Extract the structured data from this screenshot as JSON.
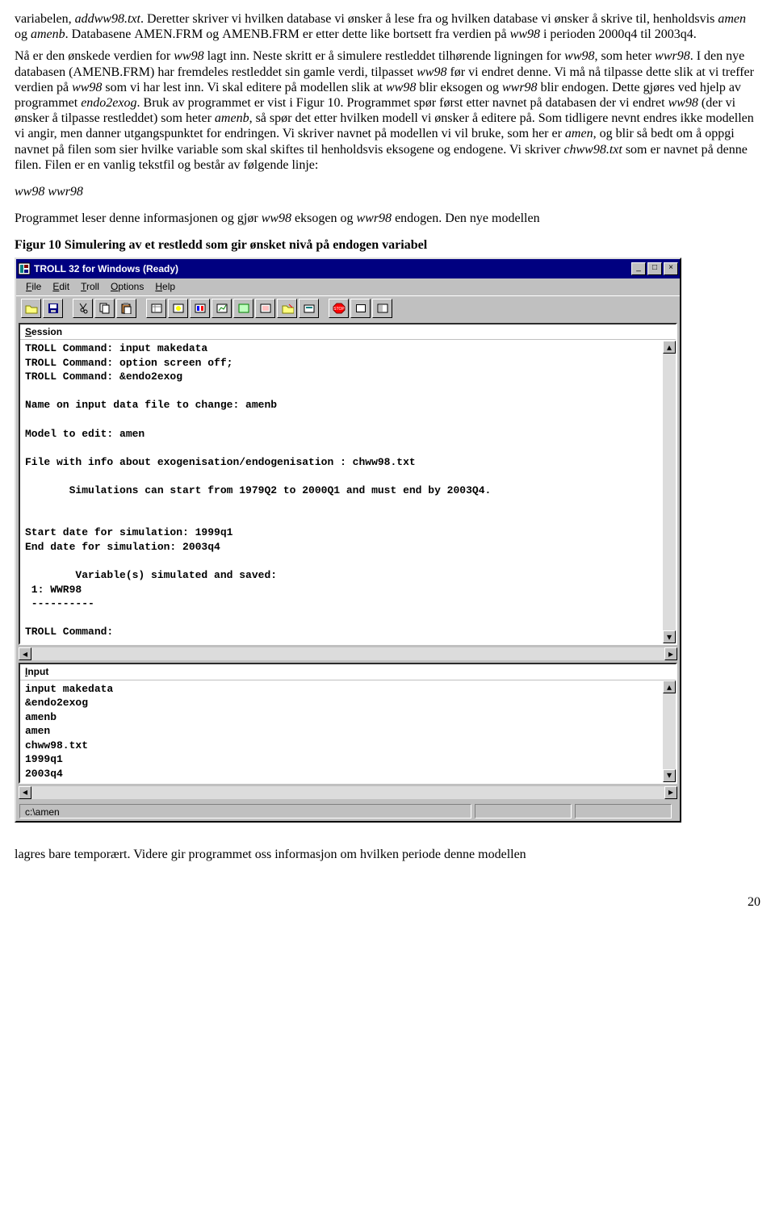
{
  "paragraph1_parts": [
    {
      "t": "variabelen, ",
      "i": false
    },
    {
      "t": "addww98.txt",
      "i": true
    },
    {
      "t": ". Deretter skriver vi hvilken database vi ønsker å lese fra og hvilken database vi ønsker å skrive til, henholdsvis ",
      "i": false
    },
    {
      "t": "amen",
      "i": true
    },
    {
      "t": " og ",
      "i": false
    },
    {
      "t": "amenb",
      "i": true
    },
    {
      "t": ". Databasene ",
      "i": false
    },
    {
      "t": "AMEN.FRM",
      "i": false,
      "sc": true
    },
    {
      "t": " og ",
      "i": false
    },
    {
      "t": "AMENB.FRM",
      "i": false,
      "sc": true
    },
    {
      "t": " er etter dette like bortsett fra verdien på ",
      "i": false
    },
    {
      "t": "ww98",
      "i": true
    },
    {
      "t": " i perioden 2000q4 til 2003q4.",
      "i": false
    }
  ],
  "paragraph2_parts": [
    {
      "t": "Nå er den ønskede verdien for ",
      "i": false
    },
    {
      "t": "ww98",
      "i": true
    },
    {
      "t": " lagt inn. Neste skritt er å simulere restleddet tilhørende ligningen for ",
      "i": false
    },
    {
      "t": "ww98",
      "i": true
    },
    {
      "t": ", som heter ",
      "i": false
    },
    {
      "t": "wwr98",
      "i": true
    },
    {
      "t": ". I den nye databasen (",
      "i": false
    },
    {
      "t": "AMENB.FRM",
      "i": false,
      "sc": true
    },
    {
      "t": ") har fremdeles restleddet sin gamle verdi, tilpasset ",
      "i": false
    },
    {
      "t": "ww98",
      "i": true
    },
    {
      "t": " før vi endret denne. Vi må nå tilpasse dette slik at vi treffer verdien på ",
      "i": false
    },
    {
      "t": "ww98",
      "i": true
    },
    {
      "t": " som vi har lest inn. Vi skal editere på modellen slik at ",
      "i": false
    },
    {
      "t": "ww98",
      "i": true
    },
    {
      "t": " blir eksogen og ",
      "i": false
    },
    {
      "t": "wwr98",
      "i": true
    },
    {
      "t": " blir endogen. Dette gjøres ved hjelp av programmet ",
      "i": false
    },
    {
      "t": "endo2exog",
      "i": true
    },
    {
      "t": ". Bruk av programmet er vist i Figur 10. Programmet spør først etter navnet på databasen der vi endret ",
      "i": false
    },
    {
      "t": "ww98",
      "i": true
    },
    {
      "t": " (der vi ønsker å tilpasse restleddet) som heter ",
      "i": false
    },
    {
      "t": "amenb",
      "i": true
    },
    {
      "t": ", så spør det etter hvilken modell vi ønsker å editere på. Som tidligere nevnt endres ikke modellen vi angir, men danner utgangspunktet for endringen. Vi skriver navnet på modellen vi vil bruke, som her er ",
      "i": false
    },
    {
      "t": "amen",
      "i": true
    },
    {
      "t": ", og blir så bedt om å oppgi navnet på filen som sier hvilke variable som skal skiftes til henholdsvis eksogene og endogene. Vi skriver ",
      "i": false
    },
    {
      "t": "chww98.txt",
      "i": true
    },
    {
      "t": " som er navnet på denne filen. Filen er en vanlig tekstfil og består av følgende linje:",
      "i": false
    }
  ],
  "codeline": "ww98 wwr98",
  "paragraph3_parts": [
    {
      "t": "Programmet leser denne informasjonen og gjør ",
      "i": false
    },
    {
      "t": "ww98",
      "i": true
    },
    {
      "t": " eksogen og ",
      "i": false
    },
    {
      "t": "wwr98",
      "i": true
    },
    {
      "t": " endogen. Den nye modellen",
      "i": false
    }
  ],
  "figure_caption": "Figur 10 Simulering av et restledd som gir ønsket nivå på endogen variabel",
  "window": {
    "title": "TROLL 32 for Windows (Ready)",
    "menus": [
      "File",
      "Edit",
      "Troll",
      "Options",
      "Help"
    ],
    "session_label": "Session",
    "session_lines": [
      "TROLL Command: input makedata",
      "TROLL Command: option screen off;",
      "TROLL Command: &endo2exog",
      "",
      "Name on input data file to change: amenb",
      "",
      "Model to edit: amen",
      "",
      "File with info about exogenisation/endogenisation : chww98.txt",
      "",
      "       Simulations can start from 1979Q2 to 2000Q1 and must end by 2003Q4.",
      "",
      "",
      "Start date for simulation: 1999q1",
      "End date for simulation: 2003q4",
      "",
      "        Variable(s) simulated and saved:",
      " 1: WWR98",
      " ----------",
      "",
      "TROLL Command:"
    ],
    "input_label": "Input",
    "input_lines": [
      "input makedata",
      "&endo2exog",
      "amenb",
      "amen",
      "chww98.txt",
      "1999q1",
      "2003q4"
    ],
    "status": "c:\\amen"
  },
  "paragraph4": "lagres bare temporært. Videre gir programmet oss informasjon om hvilken periode denne modellen",
  "page_number": "20"
}
